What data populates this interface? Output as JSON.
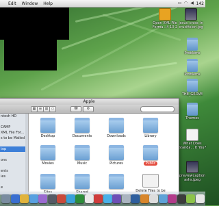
{
  "menubar": {
    "apple": "",
    "app_name": "Edit",
    "items": [
      "Window",
      "Help"
    ],
    "clock": "142"
  },
  "desktop_icons": [
    {
      "label": "Open XML File Forma...4 10 2",
      "kind": "xml"
    },
    {
      "label": "jesus_cross_in crucifixion.jpg",
      "kind": "image"
    },
    {
      "label": "Problems",
      "kind": "folder"
    },
    {
      "label": "Problems",
      "kind": "folder"
    },
    {
      "label": "THE_GROVE",
      "kind": "folder"
    },
    {
      "label": "Themes",
      "kind": "folder"
    },
    {
      "label": "What Does Standa... It You?",
      "kind": "doc"
    },
    {
      "label": "previewcaption ashs.jpeg",
      "kind": "image"
    }
  ],
  "finder": {
    "title": "Apple",
    "sidebar": [
      "ntosh HD",
      "",
      "CAMP",
      "XML File For...",
      "s to be Mailed",
      "",
      "top",
      "",
      "ons",
      "",
      "ents",
      "ies",
      "",
      "e"
    ],
    "sidebar_selected_index": 6,
    "items": [
      {
        "label": "Desktop",
        "kind": "folder"
      },
      {
        "label": "Documents",
        "kind": "folder"
      },
      {
        "label": "Downloads",
        "kind": "folder"
      },
      {
        "label": "Library",
        "kind": "folder"
      },
      {
        "label": "Movies",
        "kind": "folder"
      },
      {
        "label": "Music",
        "kind": "folder"
      },
      {
        "label": "Pictures",
        "kind": "folder"
      },
      {
        "label": "Public",
        "kind": "folder",
        "badge": true
      },
      {
        "label": "Sites",
        "kind": "folder"
      },
      {
        "label": "Shared",
        "kind": "folder"
      },
      {
        "label": "",
        "kind": "folder"
      },
      {
        "label": "Delete Files to be",
        "kind": "package"
      }
    ]
  },
  "dock": {
    "item_colors": [
      "#7a8ca0",
      "#3a6fd0",
      "#e0b33c",
      "#58a0e0",
      "#9a6ad0",
      "#555b66",
      "#c94a3b",
      "#3aa0d8",
      "#2d8d3a",
      "#e9e9e9",
      "#cf3c3c",
      "#4ab0e8",
      "#6d4fb6",
      "#aab4c0",
      "#2f5f9e",
      "#d8862c",
      "#dddddd",
      "#5da2d8",
      "#b23b8a",
      "#3c3c3c",
      "#8cc34a",
      "#e6e6e6"
    ]
  }
}
